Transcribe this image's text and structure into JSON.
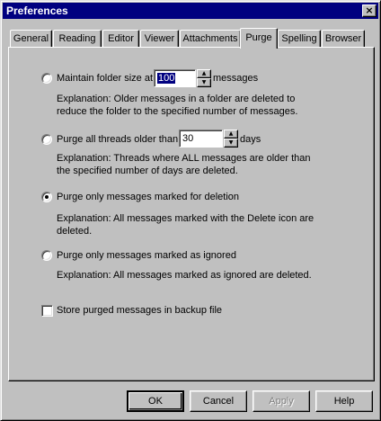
{
  "window": {
    "title": "Preferences",
    "close_glyph": "×"
  },
  "tabs": [
    {
      "label": "General"
    },
    {
      "label": "Reading"
    },
    {
      "label": "Editor"
    },
    {
      "label": "Viewer"
    },
    {
      "label": "Attachments"
    },
    {
      "label": "Purge",
      "active": true
    },
    {
      "label": "Spelling"
    },
    {
      "label": "Browser"
    }
  ],
  "purge": {
    "option1": {
      "label_pre": "Maintain folder size at",
      "value": "100",
      "label_post": "messages",
      "explanation": "Explanation: Older messages in a folder are deleted to reduce the folder to the specified number of messages.",
      "selected": false
    },
    "option2": {
      "label_pre": "Purge all threads older than",
      "value": "30",
      "label_post": "days",
      "explanation": "Explanation: Threads where ALL messages are older than the specified number of days are deleted.",
      "selected": false
    },
    "option3": {
      "label": "Purge only messages marked for deletion",
      "explanation": "Explanation: All messages marked with the Delete icon are deleted.",
      "selected": true
    },
    "option4": {
      "label": "Purge only messages marked as ignored",
      "explanation": "Explanation: All messages marked as ignored are deleted.",
      "selected": false
    },
    "backup": {
      "label": "Store purged messages in backup file",
      "checked": false
    }
  },
  "buttons": {
    "ok": "OK",
    "cancel": "Cancel",
    "apply": "Apply",
    "help": "Help"
  },
  "icons": {
    "spin_up": "▲",
    "spin_down": "▼"
  }
}
